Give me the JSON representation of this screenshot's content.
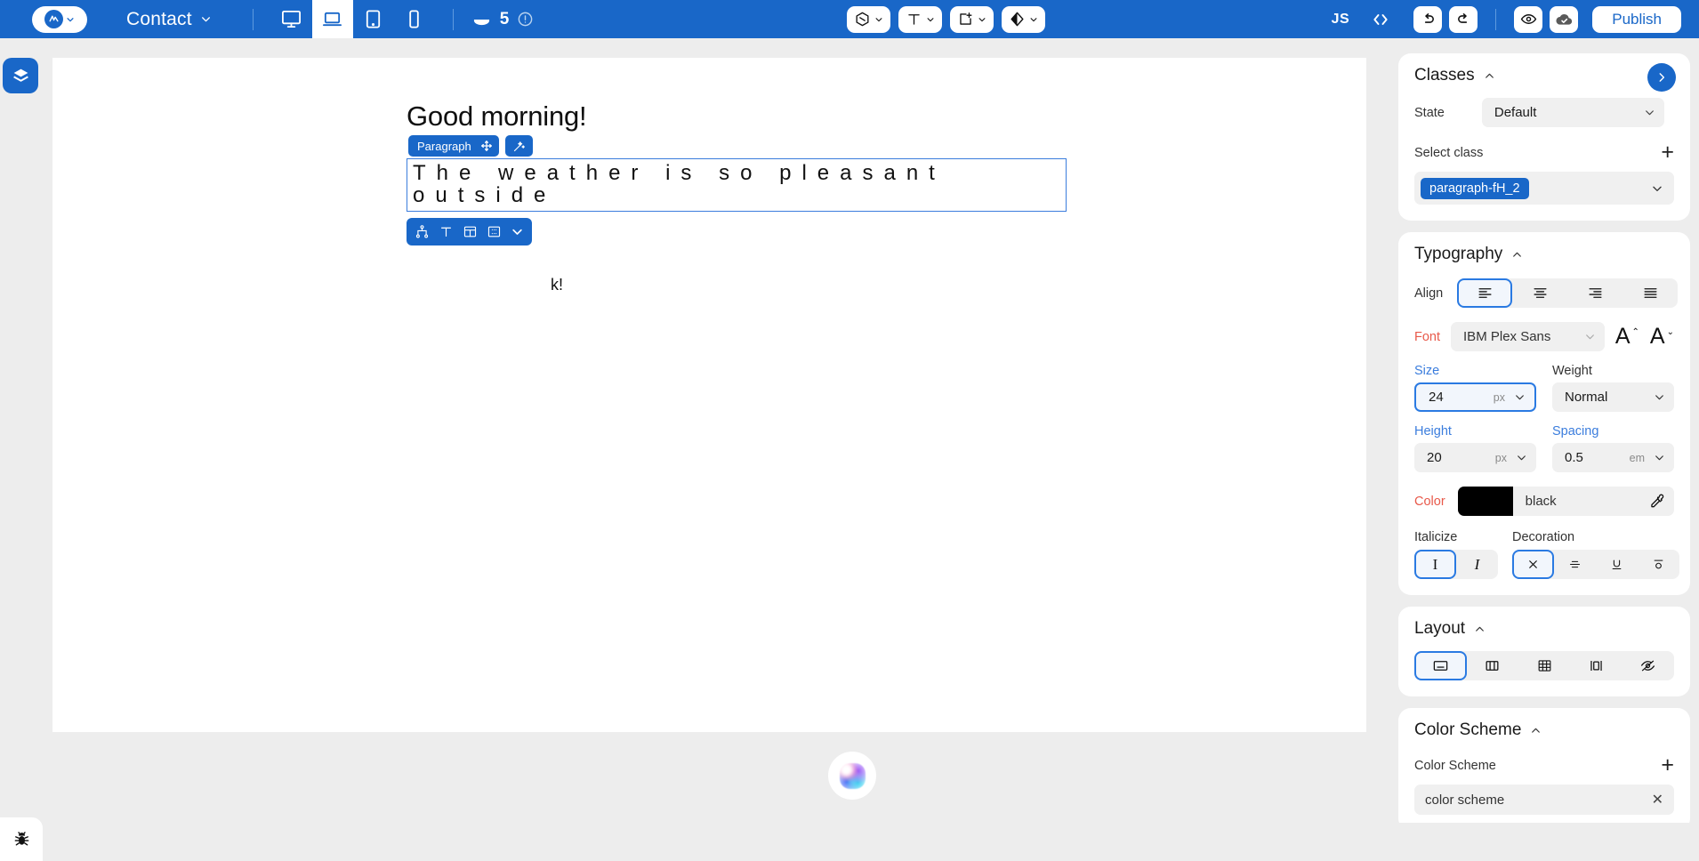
{
  "topbar": {
    "brand_icon": "app-logo-icon",
    "brand_caret": "chevron-down-icon",
    "page_name": "Contact",
    "page_caret": "chevron-down-icon",
    "devices": [
      {
        "name": "desktop",
        "icon": "monitor-icon",
        "active": false
      },
      {
        "name": "laptop",
        "icon": "laptop-icon",
        "active": true
      },
      {
        "name": "tablet",
        "icon": "tablet-icon",
        "active": false
      },
      {
        "name": "mobile",
        "icon": "phone-icon",
        "active": false
      }
    ],
    "cookie_icon": "cookie-icon",
    "cookie_count": "5",
    "info_icon": "info-circle-icon",
    "center_tools": [
      {
        "name": "assets-tool",
        "icon": "cube-icon",
        "caret": "chevron-down-icon"
      },
      {
        "name": "text-tool",
        "icon": "text-T-icon",
        "caret": "chevron-down-icon"
      },
      {
        "name": "add-element-tool",
        "icon": "add-box-icon",
        "caret": "chevron-down-icon"
      },
      {
        "name": "theme-tool",
        "icon": "contrast-diamond-icon",
        "caret": "chevron-down-icon"
      }
    ],
    "js_label": "JS",
    "code_icon": "code-brackets-icon",
    "undo_icon": "undo-arrow-icon",
    "redo_icon": "redo-arrow-icon",
    "preview_icon": "eye-icon",
    "saved_icon": "cloud-check-icon",
    "publish_label": "Publish"
  },
  "left_rail": {
    "layers_icon": "layers-icon",
    "bug_icon": "bug-icon"
  },
  "canvas": {
    "heading": "Good morning!",
    "paragraph": "The weather is so pleasant outside",
    "ghost_text": "k!",
    "tag_badge_label": "Paragraph",
    "move_icon": "move-arrows-icon",
    "wand_icon": "magic-wand-icon",
    "lower_toolbar_icons": [
      {
        "name": "node-tree-icon"
      },
      {
        "name": "text-T-icon"
      },
      {
        "name": "layout-columns-icon"
      },
      {
        "name": "spacing-box-icon"
      },
      {
        "name": "chevron-down-icon"
      }
    ],
    "ai_orb_icon": "ai-assistant-orb-icon"
  },
  "panel": {
    "classes": {
      "title": "Classes",
      "collapse_icon": "chevron-up-icon",
      "expand_icon": "chevron-right-icon",
      "state_label": "State",
      "state_value": "Default",
      "state_caret": "chevron-down-icon",
      "select_class_label": "Select class",
      "add_icon": "plus-icon",
      "class_chip": "paragraph-fH_2",
      "class_caret": "chevron-down-icon"
    },
    "typography": {
      "title": "Typography",
      "collapse_icon": "chevron-up-icon",
      "align_label": "Align",
      "align_options": [
        {
          "name": "align-left",
          "selected": true
        },
        {
          "name": "align-center",
          "selected": false
        },
        {
          "name": "align-right",
          "selected": false
        },
        {
          "name": "align-justify",
          "selected": false
        }
      ],
      "font_label": "Font",
      "font_value": "IBM Plex Sans",
      "font_caret": "chevron-down-icon",
      "increase_font_icon": "increase-font-size-icon",
      "decrease_font_icon": "decrease-font-size-icon",
      "size_label": "Size",
      "size_value": "24",
      "size_unit": "px",
      "weight_label": "Weight",
      "weight_value": "Normal",
      "height_label": "Height",
      "height_value": "20",
      "height_unit": "px",
      "spacing_label": "Spacing",
      "spacing_value": "0.5",
      "spacing_unit": "em",
      "color_label": "Color",
      "color_swatch": "#000000",
      "color_name": "black",
      "eyedropper_icon": "eyedropper-icon",
      "italicize_label": "Italicize",
      "italic_options": [
        {
          "name": "italic-off",
          "glyph": "I",
          "selected": true
        },
        {
          "name": "italic-on",
          "glyph": "I",
          "selected": false
        }
      ],
      "decoration_label": "Decoration",
      "decoration_options": [
        {
          "name": "decoration-none",
          "selected": true
        },
        {
          "name": "decoration-line-through",
          "selected": false
        },
        {
          "name": "decoration-underline",
          "selected": false
        },
        {
          "name": "decoration-overline",
          "selected": false
        }
      ]
    },
    "layout": {
      "title": "Layout",
      "collapse_icon": "chevron-up-icon",
      "options": [
        {
          "name": "display-block",
          "selected": true
        },
        {
          "name": "display-flex",
          "selected": false
        },
        {
          "name": "display-grid",
          "selected": false
        },
        {
          "name": "display-inline-flex",
          "selected": false
        },
        {
          "name": "display-none",
          "selected": false
        }
      ]
    },
    "color_scheme": {
      "title": "Color Scheme",
      "collapse_icon": "chevron-up-icon",
      "field_label": "Color Scheme",
      "add_icon": "plus-icon",
      "value": "color scheme",
      "clear_icon": "close-x-icon"
    }
  }
}
